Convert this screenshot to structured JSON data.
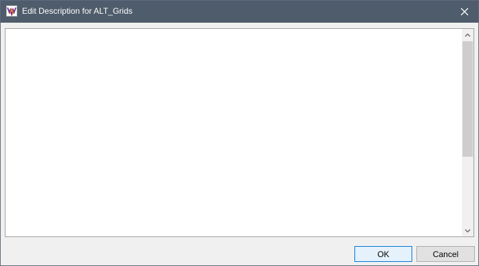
{
  "window": {
    "title": "Edit Description for ALT_Grids",
    "app_icon": "app-logo-icon",
    "close_icon": "close-icon"
  },
  "editor": {
    "value": ""
  },
  "scrollbar": {
    "up_icon": "chevron-up-icon",
    "down_icon": "chevron-down-icon"
  },
  "buttons": {
    "ok_label": "OK",
    "cancel_label": "Cancel"
  },
  "colors": {
    "titlebar": "#4f5c6b",
    "title_text": "#ffffff",
    "dialog_bg": "#f0f0f0",
    "default_button_border": "#0078d7",
    "default_button_bg": "#e5f1fb"
  }
}
